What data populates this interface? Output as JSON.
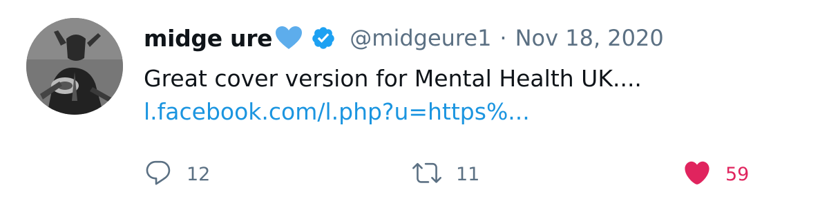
{
  "author": {
    "display_name": "midge ure",
    "name_emoji": "blue-heart-emoji",
    "verified_icon": "verified-badge-icon",
    "handle": "@midgeure1",
    "separator": "·",
    "date": "Nov 18, 2020",
    "avatar": "profile-photo"
  },
  "tweet": {
    "text": "Great cover version for Mental Health UK....",
    "link": "l.facebook.com/l.php?u=https%..."
  },
  "actions": {
    "reply": {
      "icon": "reply-icon",
      "count": "12"
    },
    "retweet": {
      "icon": "retweet-icon",
      "count": "11"
    },
    "like": {
      "icon": "heart-filled-icon",
      "count": "59"
    }
  },
  "colors": {
    "text": "#0f1419",
    "secondary": "#5b7083",
    "link": "#1b95e0",
    "like": "#e0245e",
    "verified": "#1da1f2",
    "heart_emoji": "#5dadec"
  }
}
